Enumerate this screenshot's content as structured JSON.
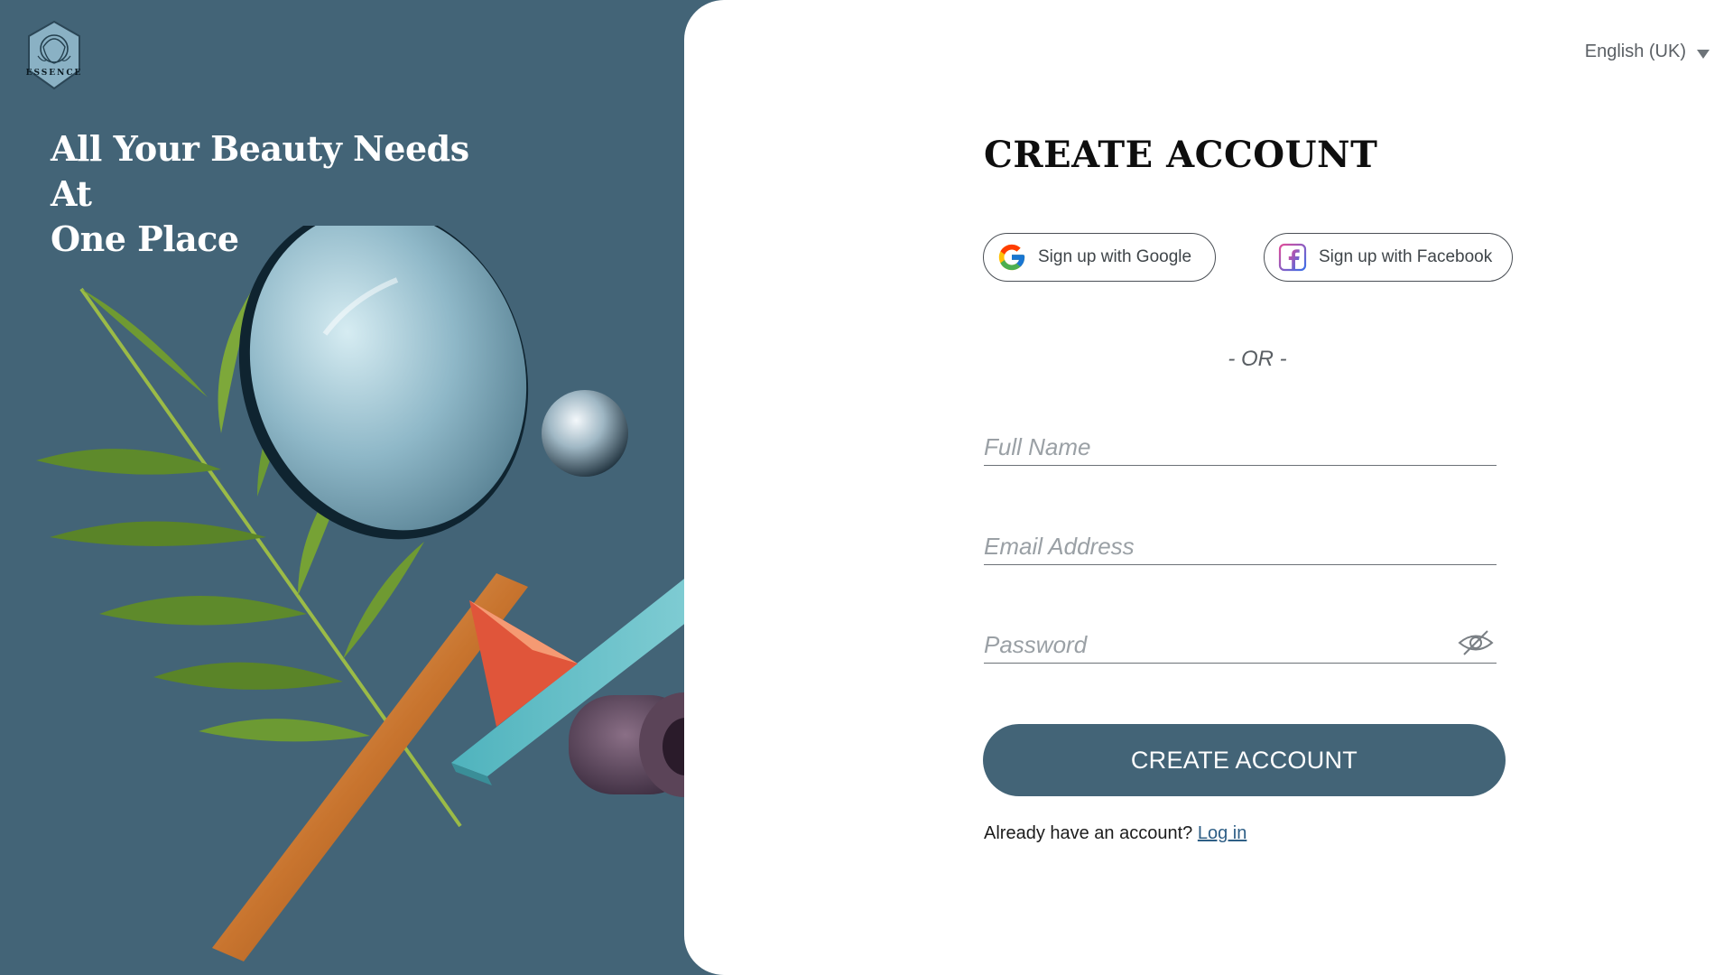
{
  "brand": {
    "logo_text": "ESSENCE",
    "accent_color": "#436477"
  },
  "hero": {
    "title_line1": "All Your Beauty Needs At",
    "title_line2": "One Place"
  },
  "language": {
    "selected": "English (UK)"
  },
  "form": {
    "title": "CREATE ACCOUNT",
    "google_button": "Sign up with Google",
    "facebook_button": "Sign up with Facebook",
    "or_divider": "- OR -",
    "full_name_placeholder": "Full Name",
    "email_placeholder": "Email Address",
    "password_placeholder": "Password",
    "submit_button": "CREATE ACCOUNT",
    "login_prompt": "Already have an account?",
    "login_link": "Log in"
  },
  "icons": {
    "google": "google-icon",
    "facebook": "facebook-icon",
    "password_toggle": "eye-off-icon",
    "language_caret": "chevron-down-icon"
  }
}
